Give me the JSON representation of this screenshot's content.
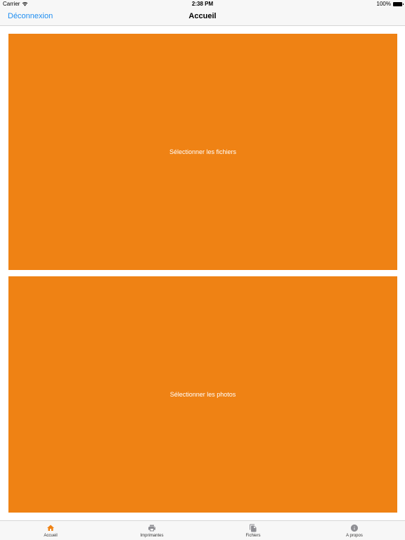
{
  "status_bar": {
    "carrier": "Carrier",
    "time": "2:38 PM",
    "battery": "100%"
  },
  "nav": {
    "back_label": "Déconnexion",
    "title": "Accueil"
  },
  "tiles": [
    {
      "label": "Sélectionner les fichiers"
    },
    {
      "label": "Sélectionner les photos"
    }
  ],
  "tabs": [
    {
      "label": "Accueil",
      "icon": "home-icon",
      "active": true
    },
    {
      "label": "Imprimantes",
      "icon": "printer-icon",
      "active": false
    },
    {
      "label": "Fichiers",
      "icon": "files-icon",
      "active": false
    },
    {
      "label": "A propos",
      "icon": "info-icon",
      "active": false
    }
  ],
  "colors": {
    "accent": "#ef8214",
    "link": "#1f8ef1",
    "tab_active": "#ef8214",
    "tab_inactive": "#8e8e93"
  }
}
